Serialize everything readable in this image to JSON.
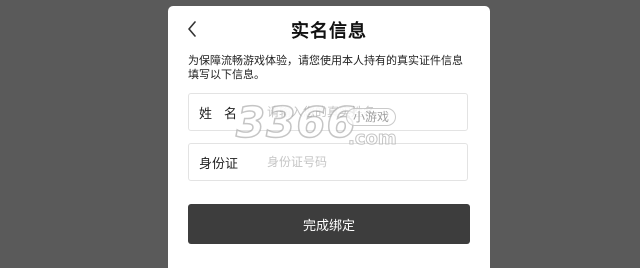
{
  "header": {
    "title": "实名信息",
    "back_icon": "chevron-left-icon"
  },
  "description": "为保障流畅游戏体验，请您使用本人持有的真实证件信息填写以下信息。",
  "form": {
    "name_label": "姓名",
    "name_placeholder": "请输入您的真实姓名",
    "id_label": "身份证",
    "id_placeholder": "身份证号码",
    "submit_label": "完成绑定"
  },
  "watermark": {
    "digits": "3366",
    "tag": "小游戏",
    "suffix": ".com"
  },
  "colors": {
    "backdrop": "#5a5a5a",
    "modal_bg": "#ffffff",
    "button_bg": "#3d3d3d",
    "placeholder": "#c6c6c6"
  }
}
